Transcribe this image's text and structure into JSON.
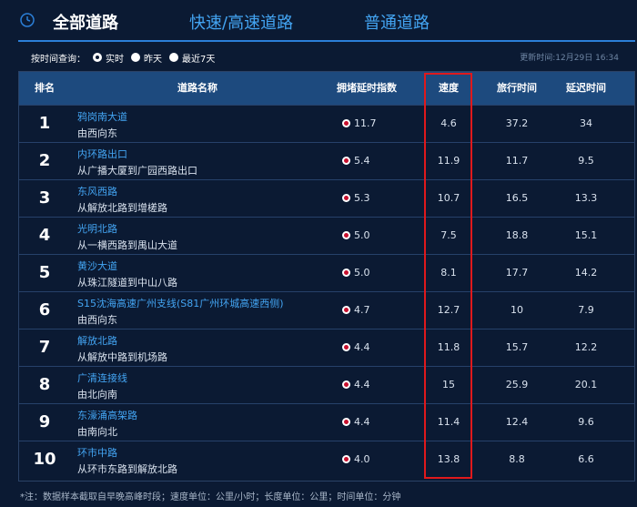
{
  "tabs": {
    "active": "全部道路",
    "highway": "快速/高速道路",
    "normal": "普通道路"
  },
  "filter": {
    "label": "按时间查询：",
    "options": [
      "实时",
      "昨天",
      "最近7天"
    ],
    "selected": "实时"
  },
  "updated": "更新时间:12月29日  16:34",
  "table": {
    "headers": {
      "rank": "排名",
      "name": "道路名称",
      "index": "拥堵延时指数",
      "speed": "速度",
      "travel": "旅行时间",
      "delay": "延迟时间"
    },
    "rows": [
      {
        "rank": "1",
        "name": "鸦岗南大道",
        "dir": "由西向东",
        "index": "11.7",
        "speed": "4.6",
        "travel": "37.2",
        "delay": "34"
      },
      {
        "rank": "2",
        "name": "内环路出口",
        "dir": "从广播大厦到广园西路出口",
        "index": "5.4",
        "speed": "11.9",
        "travel": "11.7",
        "delay": "9.5"
      },
      {
        "rank": "3",
        "name": "东风西路",
        "dir": "从解放北路到增槎路",
        "index": "5.3",
        "speed": "10.7",
        "travel": "16.5",
        "delay": "13.3"
      },
      {
        "rank": "4",
        "name": "光明北路",
        "dir": "从一横西路到禺山大道",
        "index": "5.0",
        "speed": "7.5",
        "travel": "18.8",
        "delay": "15.1"
      },
      {
        "rank": "5",
        "name": "黄沙大道",
        "dir": "从珠江隧道到中山八路",
        "index": "5.0",
        "speed": "8.1",
        "travel": "17.7",
        "delay": "14.2"
      },
      {
        "rank": "6",
        "name": "S15沈海高速广州支线(S81广州环城高速西侧)",
        "dir": "由西向东",
        "index": "4.7",
        "speed": "12.7",
        "travel": "10",
        "delay": "7.9"
      },
      {
        "rank": "7",
        "name": "解放北路",
        "dir": "从解放中路到机场路",
        "index": "4.4",
        "speed": "11.8",
        "travel": "15.7",
        "delay": "12.2"
      },
      {
        "rank": "8",
        "name": "广清连接线",
        "dir": "由北向南",
        "index": "4.4",
        "speed": "15",
        "travel": "25.9",
        "delay": "20.1"
      },
      {
        "rank": "9",
        "name": "东濠涌高架路",
        "dir": "由南向北",
        "index": "4.4",
        "speed": "11.4",
        "travel": "12.4",
        "delay": "9.6"
      },
      {
        "rank": "10",
        "name": "环市中路",
        "dir": "从环市东路到解放北路",
        "index": "4.0",
        "speed": "13.8",
        "travel": "8.8",
        "delay": "6.6"
      }
    ]
  },
  "note": "*注：数据样本截取自早晚高峰时段；速度单位：公里/小时；长度单位：公里；时间单位：分钟",
  "colors": {
    "background": "#0b1a33",
    "header": "#1d4a7e",
    "link": "#43a4f2",
    "highlight": "#e0191c",
    "congestion_dot": "#c8102e"
  }
}
